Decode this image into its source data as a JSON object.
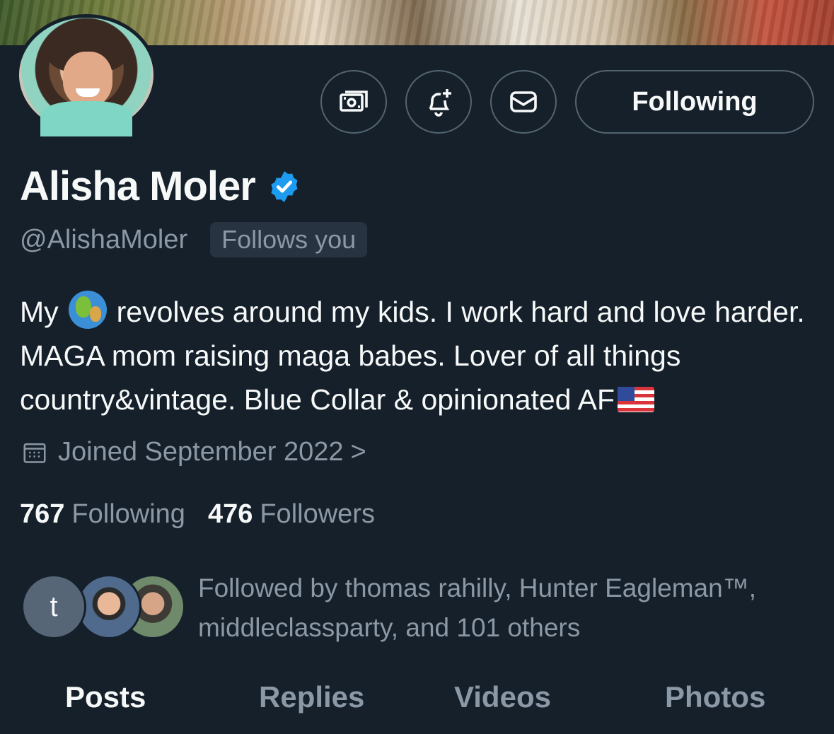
{
  "profile": {
    "display_name": "Alisha Moler",
    "handle": "@AlishaMoler",
    "follows_you_badge": "Follows you",
    "verified": true
  },
  "actions": {
    "tip_icon": "money-icon",
    "notify_icon": "bell-plus-icon",
    "message_icon": "envelope-icon",
    "following_label": "Following"
  },
  "bio": {
    "part1": "My",
    "globe_emoji": "earth-globe-icon",
    "part2": "revolves around my kids. I work hard and love harder. MAGA mom raising maga babes. Lover of all things country&vintage. Blue Collar & opinionated AF",
    "flag_emoji": "us-flag-icon"
  },
  "joined": {
    "text": "Joined September 2022",
    "chevron": ">"
  },
  "stats": {
    "following_count": "767",
    "following_label": "Following",
    "followers_count": "476",
    "followers_label": "Followers"
  },
  "followed_by": {
    "initial": "t",
    "text": "Followed by thomas rahilly, Hunter Eagleman™, middleclassparty, and 101 others"
  },
  "tabs": [
    {
      "label": "Posts",
      "active": true
    },
    {
      "label": "Replies",
      "active": false
    },
    {
      "label": "Videos",
      "active": false
    },
    {
      "label": "Photos",
      "active": false
    }
  ],
  "colors": {
    "background": "#15202b",
    "primary_text": "#f7f9f9",
    "secondary_text": "#8b98a5",
    "verified_blue": "#1d9bf0",
    "border": "#536471"
  }
}
